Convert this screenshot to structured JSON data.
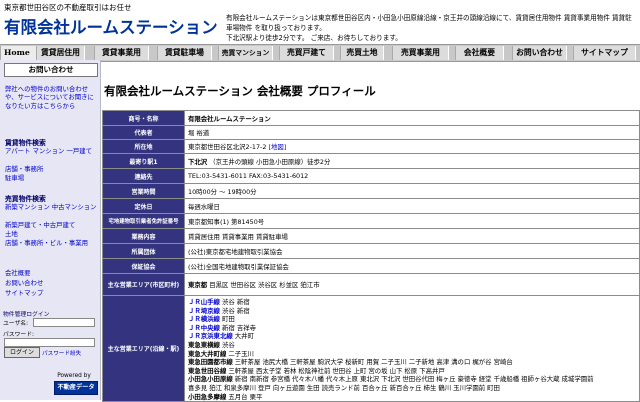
{
  "header": {
    "tagline": "東京都世田谷区の不動産取引はお任せ",
    "logo": "有限会社ルームステーション",
    "description": [
      "有限会社ルームステーションは東京都世田谷区内・小田急小田原線沿線・京王井の頭線沿線にて、賃貸居住用物件 賃貸事業用物件 賃貸駐車場物件 を取り扱っております。",
      "下北沢駅より徒歩2分です。 ご来店、お待ちしております。"
    ]
  },
  "nav": {
    "items": [
      "Home",
      "賃貸居住用",
      "賃貸事業用",
      "賃貸駐車場",
      "売買マンション",
      "売買戸建て",
      "売買土地",
      "売買事業用",
      "会社概要",
      "お問い合わせ",
      "サイトマップ"
    ]
  },
  "sidebar": {
    "contact_button": "お問い合わせ",
    "intro": "弊社への物件のお問い合わせや、サービスについてお聞きになりたい方はこちらから",
    "rental_title": "賃貸物件検索",
    "rental_links": "アパート マンション 一戸建て",
    "rental_links2": "店舗・事務所",
    "rental_links3": "駐車場",
    "sale_title": "売買物件検索",
    "sale_links": "新築マンション 中古マンション",
    "sale_links2": "新築戸建て・中古戸建て",
    "sale_links3": "土地",
    "sale_links4": "店舗・事務所・ビル・事業用",
    "misc_link1": "会社概要",
    "misc_link2": "お問い合わせ",
    "misc_link3": "サイトマップ",
    "login_title": "物件管理ログイン",
    "user_label": "ユーザ名:",
    "pass_label": "パスワード:",
    "login_button": "ログイン",
    "forgot_link": "パスワード紛失",
    "powered_by": "Powered by",
    "powered_logo": "不動産データ"
  },
  "main": {
    "title": "有限会社ルームステーション 会社概要 プロフィール",
    "rows": [
      {
        "label": "商号・名称",
        "value": "有限会社ルームステーション"
      },
      {
        "label": "代表者",
        "value": "堀 裕道"
      },
      {
        "label": "所在地",
        "value": "東京都世田谷区北沢2-17-2",
        "link": "[地図]"
      },
      {
        "label": "最寄り駅1",
        "station": "下北沢",
        "station_note": "（京王井の頭線 小田急小田原線）徒歩2分"
      },
      {
        "label": "連絡先",
        "value": "TEL:03-5431-6011 FAX:03-5431-6012"
      },
      {
        "label": "営業時間",
        "value": "10時00分 ～ 19時00分"
      },
      {
        "label": "定休日",
        "value": "毎週水曜日"
      },
      {
        "label": "宅地建物取引業者免許証番号",
        "value": "東京都知事(1) 第81450号"
      },
      {
        "label": "業務内容",
        "value": "賃貸居住用 賃貸事業用 賃貸駐車場"
      },
      {
        "label": "所属団体",
        "value": "(公社)東京都宅地建物取引業協会"
      },
      {
        "label": "保証協会",
        "value": "(公社)全国宅地建物取引業保証協会"
      },
      {
        "label": "主な営業エリア(市区町村)",
        "value_bold": "東京都",
        "value": "目黒区 世田谷区 渋谷区 杉並区 狛江市"
      },
      {
        "label": "主な営業エリア(沿線・駅)",
        "lines": [
          {
            "name": "ＪＲ山手線",
            "stations": "渋谷 新宿"
          },
          {
            "name": "ＪＲ埼京線",
            "stations": "渋谷 新宿"
          },
          {
            "name": "ＪＲ横浜線",
            "stations": "町田"
          },
          {
            "name": "ＪＲ中央線",
            "stations": "新宿 吉祥寺"
          },
          {
            "name": "ＪＲ京浜東北線",
            "stations": "大井町"
          },
          {
            "name": "東急東横線",
            "stations": "渋谷"
          },
          {
            "name": "東急大井町線",
            "stations": "二子玉川"
          },
          {
            "name": "東急田園都市線",
            "stations": "三軒茶屋 池尻大橋 三軒茶屋 駒沢大学 桜新町 用賀 二子玉川 二子新地 高津 溝の口 梶が谷 宮崎台"
          },
          {
            "name": "東急世田谷線",
            "stations": "三軒茶屋 西太子堂 若林 松陰神社前 世田谷 上町 宮の坂 山下 松原 下高井戸"
          },
          {
            "name": "小田急小田原線",
            "stations": "新宿 南新宿 参宮橋 代々木八幡 代々木上原 東北沢 下北沢 世田谷代田 梅ヶ丘 豪徳寺 経堂 千歳船橋 祖師ヶ谷大蔵 成城学園前"
          },
          {
            "name": "",
            "stations": "喜多見 狛江 和泉多摩川 登戸 向ヶ丘遊園 生田 読売ランド前 百合ヶ丘 新百合ヶ丘 柿生 鶴川 玉川学園前 町田"
          },
          {
            "name": "小田急多摩線",
            "stations": "五月台 栗平"
          }
        ]
      }
    ]
  }
}
